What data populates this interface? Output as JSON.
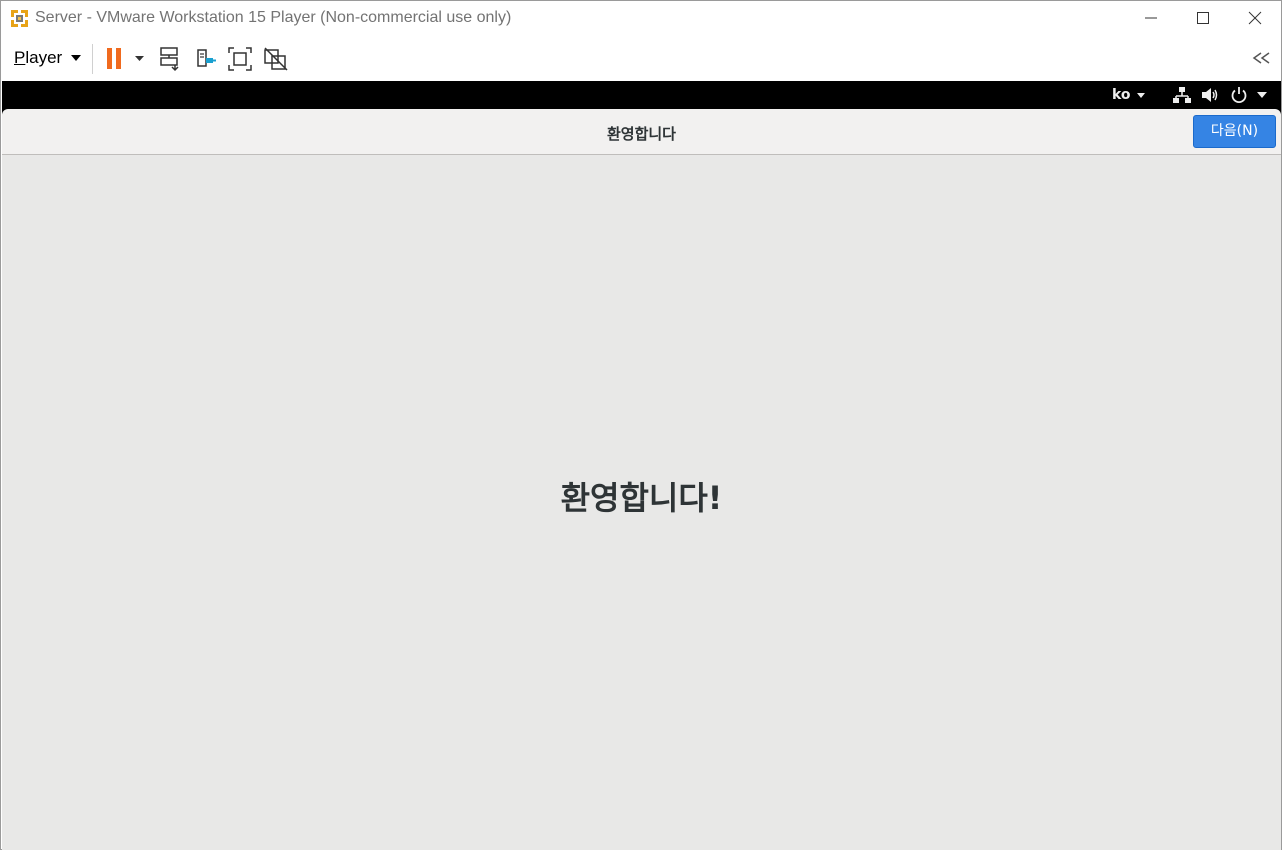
{
  "window": {
    "title": "Server - VMware Workstation 15 Player (Non-commercial use only)"
  },
  "toolbar": {
    "player_menu_label": "Player",
    "icons": [
      "pause-icon",
      "send-ctrl-alt-del-icon",
      "removable-devices-icon",
      "fullscreen-icon",
      "unity-icon",
      "collapse-toolbar-icon"
    ],
    "pause_color": "#f06a1e",
    "device_accent": "#19a0d0"
  },
  "guest": {
    "topbar": {
      "language": "ko",
      "icons": [
        "network-icon",
        "volume-icon",
        "power-icon"
      ]
    },
    "header": {
      "title": "환영합니다",
      "next_button_label": "다음(N)",
      "accent_color": "#3584e4"
    },
    "main": {
      "welcome_text": "환영합니다!"
    }
  }
}
